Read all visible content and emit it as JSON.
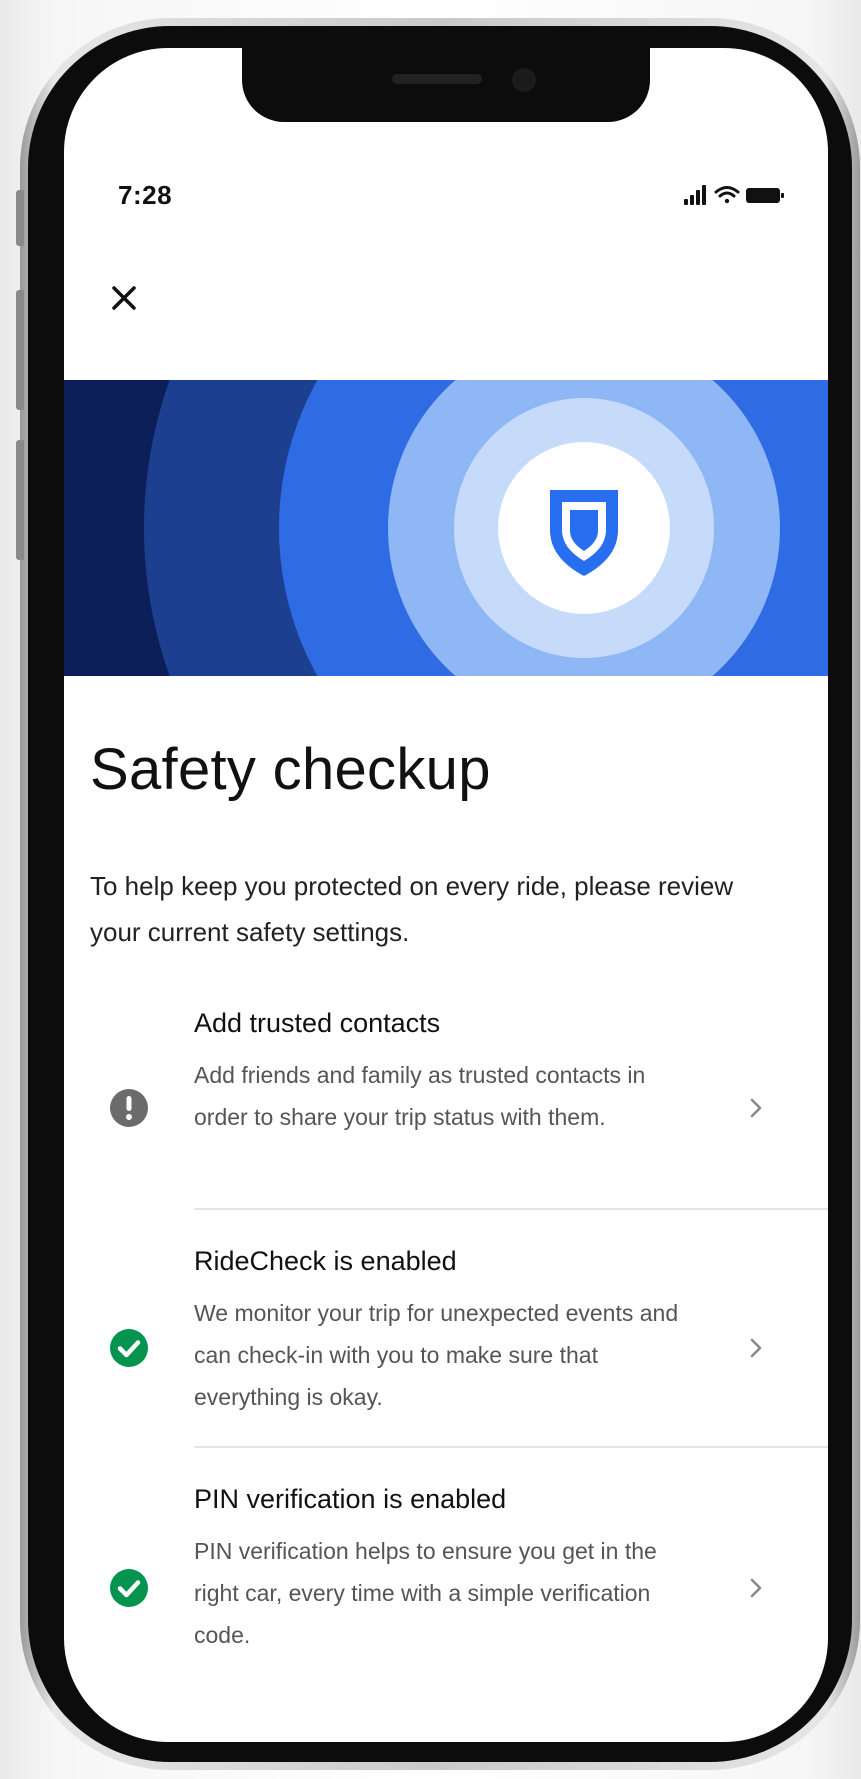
{
  "status_bar": {
    "time": "7:28",
    "icons": [
      "cellular-signal-icon",
      "wifi-icon",
      "battery-icon"
    ]
  },
  "header": {
    "close_icon": "close-icon"
  },
  "hero": {
    "icon": "shield-icon",
    "colors": {
      "navy": "#0c1f59",
      "dark_blue": "#1d3f8f",
      "blue": "#2f6be2",
      "light_blue": "#8fb6f5",
      "pale_blue": "#c6dafa",
      "shield": "#276ef1"
    }
  },
  "page": {
    "title": "Safety checkup",
    "intro": "To help keep you protected on every ride, please review your current safety settings."
  },
  "items": [
    {
      "status": "warning",
      "status_icon": "exclamation-icon",
      "title": "Add trusted contacts",
      "description": "Add friends and family as trusted contacts in order to share your trip status with them."
    },
    {
      "status": "enabled",
      "status_icon": "check-icon",
      "title": "RideCheck is enabled",
      "description": "We monitor your trip for unexpected events and can check-in with you to make sure that everything is okay."
    },
    {
      "status": "enabled",
      "status_icon": "check-icon",
      "title": "PIN verification is enabled",
      "description": "PIN verification helps to ensure you get in the right car, every time with a simple verification code."
    }
  ],
  "colors": {
    "warning": "#6b6b6b",
    "success": "#05944f",
    "chevron": "#8a8a8a"
  }
}
